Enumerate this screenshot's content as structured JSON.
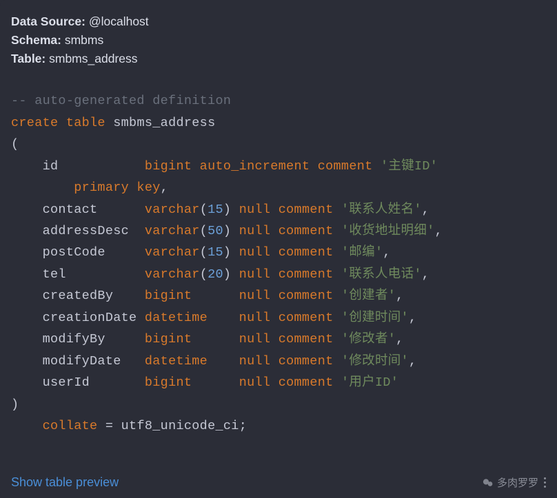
{
  "header": {
    "dataSourceLabel": "Data Source:",
    "dataSourceValue": "@localhost",
    "schemaLabel": "Schema:",
    "schemaValue": "smbms",
    "tableLabel": "Table:",
    "tableValue": "smbms_address"
  },
  "sql": {
    "comment": "-- auto-generated definition",
    "create": "create",
    "table": "table",
    "tableName": "smbms_address",
    "openParen": "(",
    "columns": [
      {
        "name": "id",
        "type": "bigint",
        "extra": "auto_increment",
        "null": "",
        "comment": "comment",
        "string": "'主键ID'",
        "trail": ""
      },
      {
        "primaryKey": "primary key",
        "trail": ","
      },
      {
        "name": "contact",
        "type": "varchar",
        "size": "15",
        "null": "null",
        "comment": "comment",
        "string": "'联系人姓名'",
        "trail": ","
      },
      {
        "name": "addressDesc",
        "type": "varchar",
        "size": "50",
        "null": "null",
        "comment": "comment",
        "string": "'收货地址明细'",
        "trail": ","
      },
      {
        "name": "postCode",
        "type": "varchar",
        "size": "15",
        "null": "null",
        "comment": "comment",
        "string": "'邮编'",
        "trail": ","
      },
      {
        "name": "tel",
        "type": "varchar",
        "size": "20",
        "null": "null",
        "comment": "comment",
        "string": "'联系人电话'",
        "trail": ","
      },
      {
        "name": "createdBy",
        "type": "bigint",
        "null": "null",
        "comment": "comment",
        "string": "'创建者'",
        "trail": ","
      },
      {
        "name": "creationDate",
        "type": "datetime",
        "null": "null",
        "comment": "comment",
        "string": "'创建时间'",
        "trail": ","
      },
      {
        "name": "modifyBy",
        "type": "bigint",
        "null": "null",
        "comment": "comment",
        "string": "'修改者'",
        "trail": ","
      },
      {
        "name": "modifyDate",
        "type": "datetime",
        "null": "null",
        "comment": "comment",
        "string": "'修改时间'",
        "trail": ","
      },
      {
        "name": "userId",
        "type": "bigint",
        "null": "null",
        "comment": "comment",
        "string": "'用户ID'",
        "trail": ""
      }
    ],
    "closeParen": ")",
    "collate": "collate",
    "equals": "=",
    "collateValue": "utf8_unicode_ci",
    "semicolon": ";"
  },
  "footer": {
    "link": "Show table preview",
    "watermark": "多肉罗罗"
  }
}
